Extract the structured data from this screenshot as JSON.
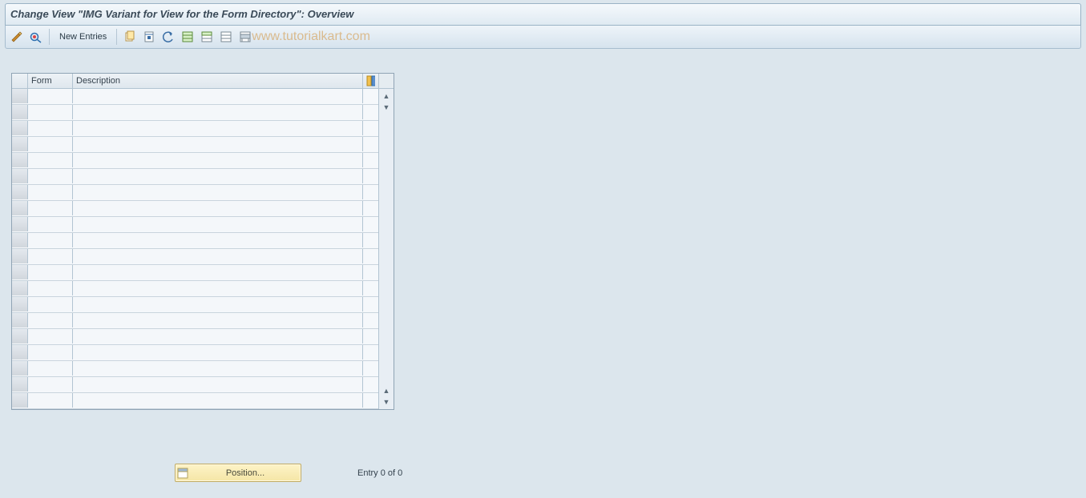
{
  "title": "Change View \"IMG Variant for View for the Form Directory\": Overview",
  "toolbar": {
    "new_entries": "New Entries"
  },
  "watermark": "www.tutorialkart.com",
  "table": {
    "columns": {
      "form": "Form",
      "description": "Description"
    },
    "row_count": 20
  },
  "footer": {
    "position_label": "Position...",
    "entry_text": "Entry 0 of 0"
  }
}
